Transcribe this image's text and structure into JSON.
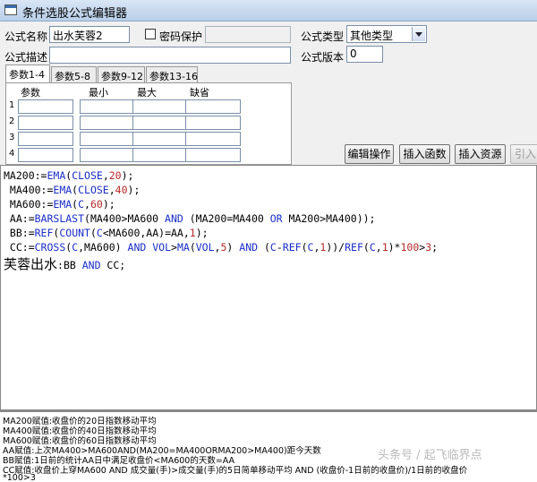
{
  "window": {
    "title": "条件选股公式编辑器"
  },
  "form": {
    "name_label": "公式名称",
    "name_value": "出水芙蓉2",
    "password_label": "密码保护",
    "type_label": "公式类型",
    "type_value": "其他类型",
    "desc_label": "公式描述",
    "desc_value": "",
    "version_label": "公式版本",
    "version_value": "0"
  },
  "tabs": [
    "参数1-4",
    "参数5-8",
    "参数9-12",
    "参数13-16"
  ],
  "params": {
    "headers": [
      "参数",
      "最小",
      "最大",
      "缺省"
    ],
    "rows": [
      "1",
      "2",
      "3",
      "4"
    ]
  },
  "buttons": {
    "edit": "编辑操作",
    "insert_func": "插入函数",
    "insert_res": "插入资源",
    "import": "引入"
  },
  "code": {
    "l1_a": "MA200:=",
    "l1_b": "EMA",
    "l1_c": "(",
    "l1_d": "CLOSE",
    "l1_e": ",",
    "l1_f": "20",
    "l1_g": ");",
    "l2_a": " MA400:=",
    "l2_b": "EMA",
    "l2_c": "(",
    "l2_d": "CLOSE",
    "l2_e": ",",
    "l2_f": "40",
    "l2_g": ");",
    "l3_a": " MA600:=",
    "l3_b": "EMA",
    "l3_c": "(",
    "l3_d": "C",
    "l3_e": ",",
    "l3_f": "60",
    "l3_g": ");",
    "l4_a": " AA:=",
    "l4_b": "BARSLAST",
    "l4_c": "(MA400>MA600 ",
    "l4_d": "AND",
    "l4_e": " (MA200=MA400 ",
    "l4_f": "OR",
    "l4_g": " MA200>MA400));",
    "l5_a": " BB:=",
    "l5_b": "REF",
    "l5_c": "(",
    "l5_d": "COUNT",
    "l5_e": "(",
    "l5_f": "C",
    "l5_g": "<MA600,AA)=AA,",
    "l5_h": "1",
    "l5_i": ");",
    "l6_a": " CC:=",
    "l6_b": "CROSS",
    "l6_c": "(",
    "l6_d": "C",
    "l6_e": ",MA600) ",
    "l6_f": "AND",
    "l6_g": " ",
    "l6_h": "VOL",
    "l6_i": ">",
    "l6_j": "MA",
    "l6_k": "(",
    "l6_l": "VOL",
    "l6_m": ",",
    "l6_n": "5",
    "l6_o": ") ",
    "l6_p": "AND",
    "l6_q": " (",
    "l6_r": "C",
    "l6_s": "-",
    "l6_t": "REF",
    "l6_u": "(",
    "l6_v": "C",
    "l6_w": ",",
    "l6_x": "1",
    "l6_y": "))/",
    "l6_z": "REF",
    "l6_aa": "(",
    "l6_ab": "C",
    "l6_ac": ",",
    "l6_ad": "1",
    "l6_ae": ")*",
    "l6_af": "100",
    "l6_ag": ">",
    "l6_ah": "3",
    "l6_ai": ";",
    "l7_a": "芙蓉出水",
    "l7_b": ":BB ",
    "l7_c": "AND",
    "l7_d": " CC;"
  },
  "descriptions": [
    "MA200赋值:收盘价的20日指数移动平均",
    "MA400赋值:收盘价的40日指数移动平均",
    "MA600赋值:收盘价的60日指数移动平均",
    "AA赋值:上次MA400>MA600AND(MA200=MA400ORMA200>MA400)距今天数",
    "BB赋值:1日前的统计AA日中满足收盘价<MA600的天数=AA",
    "CC赋值:收盘价上穿MA600 AND 成交量(手)>成交量(手)的5日简单移动平均 AND (收盘价-1日前的收盘价)/1日前的收盘价",
    "*100>3"
  ],
  "watermark": "头条号 / 起飞临界点"
}
